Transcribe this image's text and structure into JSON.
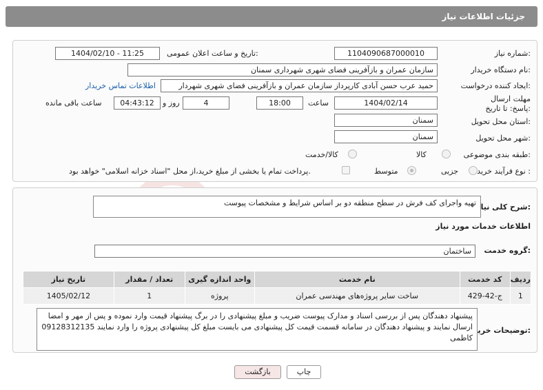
{
  "header": {
    "title": "جزئیات اطلاعات نیاز"
  },
  "form": {
    "need_number_label": "شماره نیاز:",
    "need_number": "1104090687000010",
    "announce_label": "تاریخ و ساعت اعلان عمومی:",
    "announce_value": "1404/02/10 - 11:25",
    "buyer_org_label": "نام دستگاه خریدار:",
    "buyer_org": "سازمان عمران و بازآفرینی فضای شهری شهرداری سمنان",
    "requester_label": "ایجاد کننده درخواست:",
    "requester": "حمید عرب حسن آبادی کارپرداز سازمان عمران و بازآفرینی فضای شهری شهردار",
    "buyer_contact_link": "اطلاعات تماس خریدار",
    "deadline_label": "مهلت ارسال پاسخ: تا تاریخ:",
    "deadline_date": "1404/02/14",
    "time_label": "ساعت",
    "deadline_time": "18:00",
    "days_value": "4",
    "days_label": "روز و",
    "remaining_time": "04:43:12",
    "remaining_label": "ساعت باقی مانده",
    "province_label": "استان محل تحویل:",
    "province": "سمنان",
    "city_label": "شهر محل تحویل:",
    "city": "سمنان",
    "category_label": "طبقه بندی موضوعی:",
    "category_options": [
      "کالا",
      "کالا/خدمت"
    ],
    "process_label": "نوع فرآیند خرید :",
    "process_options": [
      "جزیی",
      "متوسط"
    ],
    "payment_note": "پرداخت تمام یا بخشی از مبلغ خرید،از محل \"اسناد خزانه اسلامی\" خواهد بود."
  },
  "summary": {
    "label": "شرح کلی نیاز:",
    "text": "تهیه واجرای کف فرش در سطح منطقه دو بر اساس شرایط و مشخصات پیوست"
  },
  "services": {
    "heading": "اطلاعات خدمات مورد نیاز",
    "group_label": "گروه خدمت:",
    "group_value": "ساختمان",
    "columns": [
      "ردیف",
      "کد خدمت",
      "نام خدمت",
      "واحد اندازه گیری",
      "تعداد / مقدار",
      "تاریخ نیاز"
    ],
    "rows": [
      [
        "1",
        "ج-42-429",
        "ساخت سایر پروژه‌های مهندسی عمران",
        "پروژه",
        "1",
        "1405/02/12"
      ]
    ]
  },
  "notes": {
    "label": "توضیحات خریدار:",
    "text": "پیشنهاد دهندگان پس از بررسی اسناد و مدارک پیوست ضریب و مبلغ پیشنهادی را در برگ پیشنهاد قیمت وارد نموده و پس از مهر و امضا ارسال نمایند و پیشنهاد دهندگان در سامانه قسمت قیمت کل پیشنهادی می بایست مبلغ کل پیشنهادی پروژه را وارد نمایند 09128312135 کاظمی"
  },
  "buttons": {
    "print": "چاپ",
    "back": "بازگشت"
  },
  "colors": {
    "header_bg": "#8c8c8c",
    "link": "#1a5fa8",
    "back_button": "#f6e6e6"
  }
}
